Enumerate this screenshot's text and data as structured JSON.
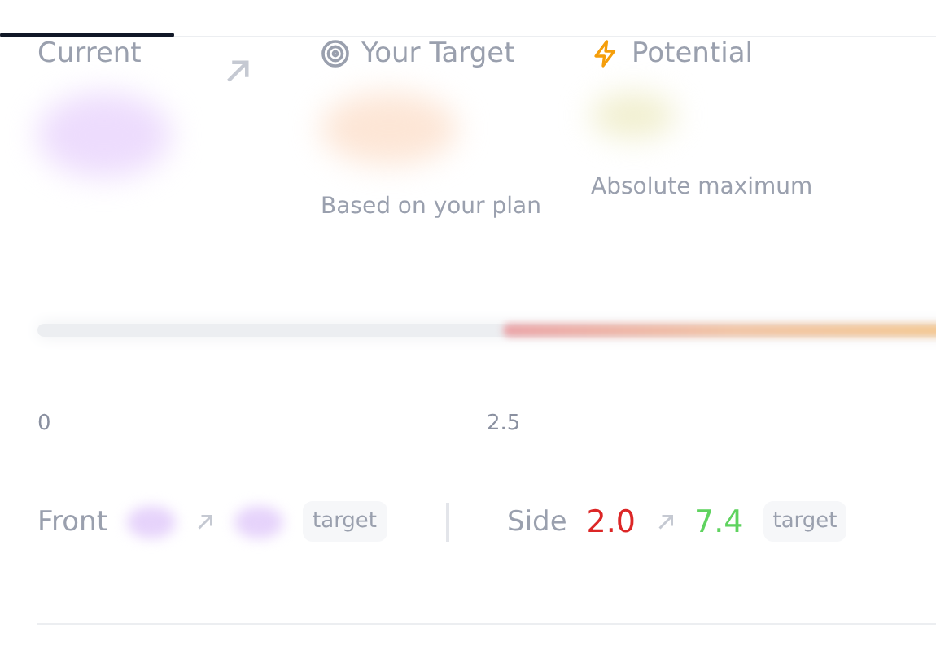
{
  "tabs": [
    {
      "selected": true
    }
  ],
  "summary": [
    {
      "kind": "current",
      "title": "Current",
      "arrow": true
    },
    {
      "kind": "target",
      "title": "Your Target",
      "caption": "Based on your plan"
    },
    {
      "kind": "potential",
      "title": "Potential",
      "caption": "Absolute maximum"
    }
  ],
  "scale": {
    "level": 0.5,
    "ticks": [
      "0",
      "2.5"
    ]
  },
  "views": [
    {
      "label": "Front",
      "badge": "target"
    },
    {
      "label": "Side",
      "from": "2.0",
      "to": "7.4",
      "badge": "target"
    }
  ]
}
